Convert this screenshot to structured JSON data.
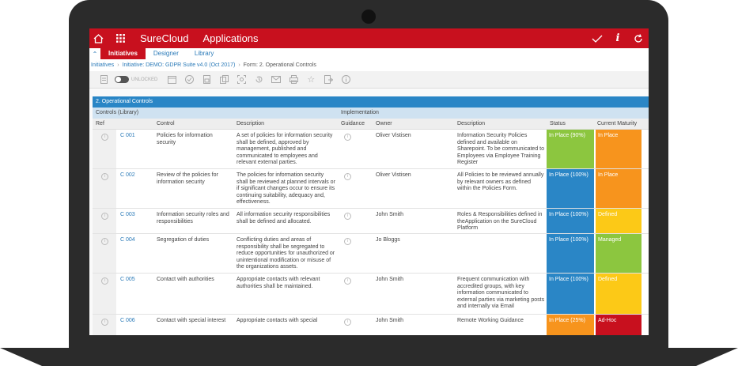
{
  "colors": {
    "brand_red": "#c8101e",
    "link_blue": "#2a7ab8",
    "section_blue": "#2a86c6",
    "status_green": "#8cc63f",
    "status_blue": "#2a86c6",
    "status_orange": "#f7941d",
    "maturity_orange": "#f7941d",
    "maturity_yellow": "#fcc917",
    "maturity_green": "#8cc63f",
    "maturity_red": "#c8101e"
  },
  "topbar": {
    "home_icon": "home-icon",
    "grid_icon": "apps-grid-icon",
    "brand": "SureCloud",
    "apps": "Applications",
    "check_icon": "check-icon",
    "info_icon": "info-icon",
    "refresh_icon": "refresh-icon"
  },
  "nav": {
    "tabs": [
      {
        "label": "Initiatives",
        "active": true
      },
      {
        "label": "Designer",
        "active": false
      },
      {
        "label": "Library",
        "active": false
      }
    ]
  },
  "breadcrumb": {
    "items": [
      "Initiatives",
      "Initiative: DEMO: GDPR Suite v4.0 (Oct 2017)",
      "Form: 2. Operational Controls"
    ]
  },
  "toolbar": {
    "lock_label": "UNLOCKED"
  },
  "table": {
    "section_title": "2. Operational Controls",
    "group_left": "Controls (Library)",
    "group_right": "Implementation",
    "columns": {
      "ref": "Ref",
      "control": "Control",
      "description": "Description",
      "guidance": "Guidance",
      "owner": "Owner",
      "impl_description": "Description",
      "status": "Status",
      "maturity": "Current Maturity"
    },
    "rows": [
      {
        "ref": "C 001",
        "control": "Policies for information security",
        "description": "A set of policies for information security shall be defined, approved by management, published and communicated to employees and relevant external parties.",
        "owner": "Oliver Vistisen",
        "impl_description": "Information Security Policies defined and available on Sharepoint. To be communicated to Employees via Employee Training Register",
        "status": "In Place (90%)",
        "status_color": "#8cc63f",
        "maturity": "In Place",
        "maturity_color": "#f7941d"
      },
      {
        "ref": "C 002",
        "control": "Review of the policies for information security",
        "description": "The policies for information security shall be reviewed at planned intervals or if significant changes occur to ensure its continuing suitability, adequacy and, effectiveness.",
        "owner": "Oliver Vistisen",
        "impl_description": "All Policies to be reviewed annually by relevant owners as defined within the Policies Form.",
        "status": "In Place (100%)",
        "status_color": "#2a86c6",
        "maturity": "In Place",
        "maturity_color": "#f7941d"
      },
      {
        "ref": "C 003",
        "control": "Information security roles and responsibilities",
        "description": "All information security responsibilities shall be defined and allocated.",
        "owner": "John Smith",
        "impl_description": "Roles & Responsibilities defined in theApplication on the SureCloud Platform",
        "status": "In Place (100%)",
        "status_color": "#2a86c6",
        "maturity": "Defined",
        "maturity_color": "#fcc917"
      },
      {
        "ref": "C 004",
        "control": "Segregation of duties",
        "description": "Conflicting duties and areas of responsibility shall be segregated to reduce opportunities for unauthorized or unintentional modification or misuse of the organizations assets.",
        "owner": "Jo Bloggs",
        "impl_description": "",
        "status": "In Place (100%)",
        "status_color": "#2a86c6",
        "maturity": "Managed",
        "maturity_color": "#8cc63f"
      },
      {
        "ref": "C 005",
        "control": "Contact with authorities",
        "description": "Appropriate contacts with relevant authorities shall be maintained.",
        "owner": "John Smith",
        "impl_description": "Frequent communication with accredited groups, with key information communicated to external parties via marketing posts and internally via Email",
        "status": "In Place (100%)",
        "status_color": "#2a86c6",
        "maturity": "Defined",
        "maturity_color": "#fcc917"
      },
      {
        "ref": "C 006",
        "control": "Contact with special interest",
        "description": "Appropriate contacts with special",
        "owner": "John Smith",
        "impl_description": "Remote Working Guidance",
        "status": "In Place (25%)",
        "status_color": "#f7941d",
        "maturity": "Ad-Hoc",
        "maturity_color": "#c8101e"
      }
    ]
  }
}
